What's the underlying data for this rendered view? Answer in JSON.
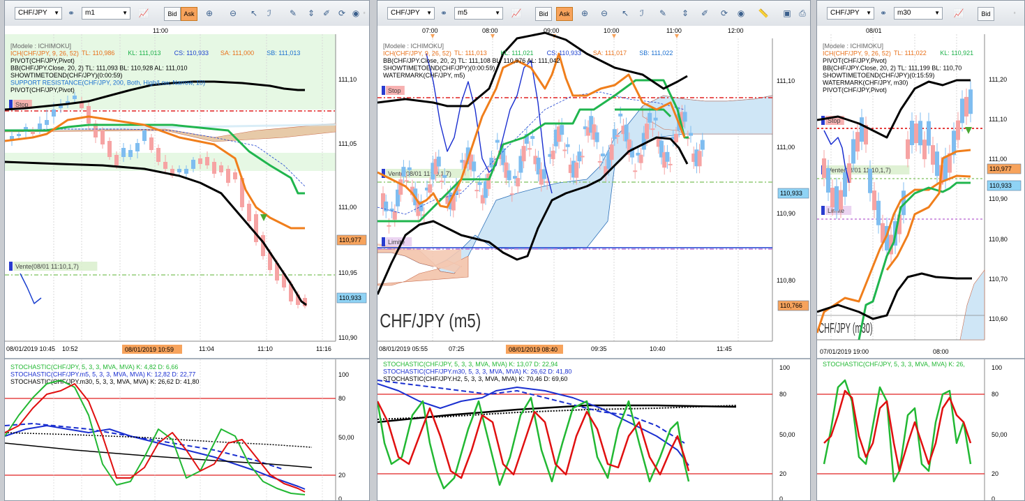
{
  "panels": [
    {
      "id": "p1",
      "symbol": "CHF/JPY",
      "timeframe": "m1",
      "bid": "Bid",
      "ask": "Ask",
      "indicators": [
        {
          "text": "[Modele : ICHIMOKU]",
          "color": "#666666"
        },
        {
          "text": "ICH(CHF/JPY, 9, 26, 52)",
          "color": "#e8701a"
        },
        {
          "text": "PIVOT(CHF/JPY,Pivot)",
          "color": "#000000"
        },
        {
          "text": "BB(CHF/JPY.Close, 20, 2)  TL: 111,093  BL: 110,928  AL: 111,010",
          "color": "#000000"
        },
        {
          "text": "SHOWTIMETOEND(CHF/JPY)(0:00:59)",
          "color": "#000000"
        },
        {
          "text": "SUPPORT RESISTANCE(CHF/JPY, 200, Both, High/Low, Narrow, 10)",
          "color": "#1a6fd0"
        },
        {
          "text": "PIVOT(CHF/JPY,Pivot)",
          "color": "#000000"
        }
      ],
      "ich_values": [
        {
          "text": "TL: 110,986",
          "color": "#e8701a"
        },
        {
          "text": "KL: 111,013",
          "color": "#1db14a"
        },
        {
          "text": "CS: 110,933",
          "color": "#1a3fcf"
        },
        {
          "text": "SA: 111,000",
          "color": "#e8701a"
        },
        {
          "text": "SB: 111,013",
          "color": "#1a6fd0"
        }
      ],
      "top_times": [
        "11:00"
      ],
      "price_ticks": [
        "111,10",
        "111,05",
        "111,00",
        "110,95",
        "110,90"
      ],
      "price_tags": [
        {
          "text": "110,977",
          "color": "#f7a35c"
        },
        {
          "text": "110,933",
          "color": "#8fd3f5"
        }
      ],
      "time_ticks": [
        "08/01/2019 10:45",
        "10:52",
        "11:04",
        "11:10",
        "11:16"
      ],
      "cursor_time": "08/01/2019 10:59",
      "stop_label": "Stop",
      "vente_label": "Vente(08/01 11:10,1,7)",
      "stoch_labels": [
        {
          "text": "STOCHASTIC(CHF/JPY, 5, 3, 3, MVA, MVA)  K: 4,82  D: 6,66",
          "color": "#22b833",
          "dcolor": "#e01010"
        },
        {
          "text": "STOCHASTIC(CHF/JPY.m5, 5, 3, 3, MVA, MVA)  K: 12,82  D: 22,77",
          "color": "#1a2fd0"
        },
        {
          "text": "STOCHASTIC(CHF/JPY.m30, 5, 3, 3, MVA, MVA)  K: 26,62  D: 41,80",
          "color": "#000000"
        }
      ],
      "stoch_ticks": [
        "100",
        "80",
        "50,00",
        "20",
        "0"
      ]
    },
    {
      "id": "p2",
      "symbol": "CHF/JPY",
      "timeframe": "m5",
      "bid": "Bid",
      "ask": "Ask",
      "indicators": [
        {
          "text": "[Modele : ICHIMOKU]",
          "color": "#666666"
        },
        {
          "text": "ICH(CHF/JPY, 9, 26, 52)",
          "color": "#e8701a"
        },
        {
          "text": "BB(CHF/JPY.Close, 20, 2)  TL: 111,108  BL: 110,976  AL: 111,042",
          "color": "#000000"
        },
        {
          "text": "SHOWTIMETOEND(CHF/JPY)(0:00:59)",
          "color": "#000000"
        },
        {
          "text": "WATERMARK(CHF/JPY, m5)",
          "color": "#000000"
        }
      ],
      "ich_values": [
        {
          "text": "TL: 111,013",
          "color": "#e8701a"
        },
        {
          "text": "KL: 111,021",
          "color": "#1db14a"
        },
        {
          "text": "CS: 110,933",
          "color": "#1a3fcf"
        },
        {
          "text": "SA: 111,017",
          "color": "#e8701a"
        },
        {
          "text": "SB: 111,022",
          "color": "#1a6fd0"
        }
      ],
      "top_times": [
        "07:00",
        "08:00",
        "09:00",
        "10:00",
        "11:00",
        "12:00"
      ],
      "price_ticks": [
        "111,10",
        "111,00",
        "110,90",
        "110,80"
      ],
      "price_tags": [
        {
          "text": "110,933",
          "color": "#8fd3f5"
        },
        {
          "text": "110,766",
          "color": "#f7a35c"
        }
      ],
      "time_ticks": [
        "08/01/2019 05:55",
        "07:25",
        "09:35",
        "10:40",
        "11:45"
      ],
      "cursor_time": "08/01/2019 08:40",
      "watermark": "CHF/JPY (m5)",
      "stop_label": "Stop",
      "vente_label": "Vente(08/01 11:10,1,7)",
      "limite_label": "Limite",
      "stoch_labels": [
        {
          "text": "STOCHASTIC(CHF/JPY, 5, 3, 3, MVA, MVA)  K: 13,07  D: 22,94",
          "color": "#22b833"
        },
        {
          "text": "STOCHASTIC(CHF/JPY.m30, 5, 3, 3, MVA, MVA)  K: 26,62  D: 41,80",
          "color": "#1a2fd0"
        },
        {
          "text": "STOCHASTIC(CHF/JPY.H2, 5, 3, 3, MVA, MVA)  K: 70,46  D: 69,60",
          "color": "#000000"
        }
      ],
      "stoch_ticks": [
        "100",
        "80",
        "50,00",
        "20",
        "0"
      ]
    },
    {
      "id": "p3",
      "symbol": "CHF/JPY",
      "timeframe": "m30",
      "bid": "Bid",
      "indicators": [
        {
          "text": "[Modele : ICHIMOKU]",
          "color": "#666666"
        },
        {
          "text": "ICH(CHF/JPY, 9, 26, 52)",
          "color": "#e8701a"
        },
        {
          "text": "PIVOT(CHF/JPY,Pivot)",
          "color": "#000000"
        },
        {
          "text": "BB(CHF/JPY.Close, 20, 2)  TL: 111,199  BL: 110,70",
          "color": "#000000"
        },
        {
          "text": "SHOWTIMETOEND(CHF/JPY)(0:15:59)",
          "color": "#000000"
        },
        {
          "text": "WATERMARK(CHF/JPY, m30)",
          "color": "#000000"
        },
        {
          "text": "PIVOT(CHF/JPY,Pivot)",
          "color": "#000000"
        }
      ],
      "ich_values": [
        {
          "text": "TL: 111,022",
          "color": "#e8701a"
        },
        {
          "text": "KL: 110,921",
          "color": "#1db14a"
        }
      ],
      "top_times": [
        "08/01"
      ],
      "price_ticks": [
        "111,20",
        "111,10",
        "111,00",
        "110,90",
        "110,80",
        "110,70",
        "110,60"
      ],
      "price_tags": [
        {
          "text": "110,977",
          "color": "#f7a35c"
        },
        {
          "text": "110,933",
          "color": "#8fd3f5"
        }
      ],
      "time_ticks": [
        "07/01/2019 19:00",
        "08:00"
      ],
      "watermark": "CHF/JPY (m30)",
      "stop_label": "Stop",
      "vente_label": "Vente(08/01 11:10,1,7)",
      "limite_label": "Limite",
      "stoch_labels": [
        {
          "text": "STOCHASTIC(CHF/JPY, 5, 3, 3, MVA, MVA)  K: 26,",
          "color": "#22b833"
        }
      ],
      "stoch_ticks": [
        "100",
        "80",
        "50,00",
        "20",
        "0"
      ]
    }
  ],
  "colors": {
    "bull": "#7fbdf0",
    "bear": "#f6a3a3",
    "tenkan": "#f07e1b",
    "kijun": "#20b54e",
    "chikou": "#000000",
    "stop": "#e02020",
    "vente": "#7cc05b",
    "limite": "#c27ad8"
  }
}
